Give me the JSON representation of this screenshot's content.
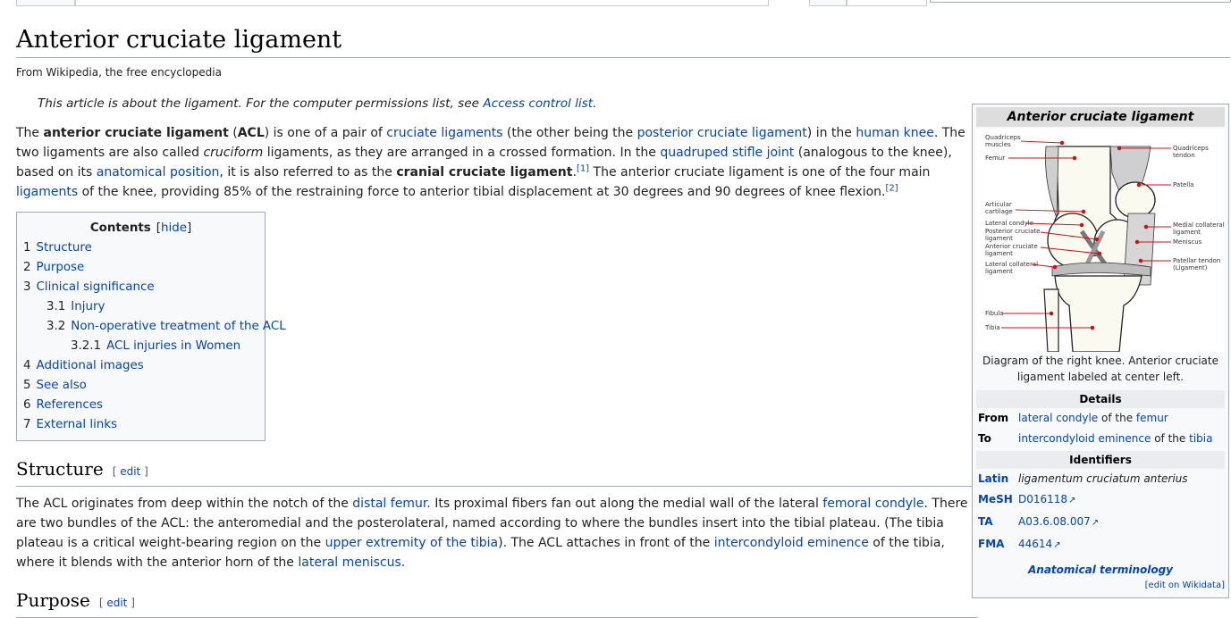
{
  "article": {
    "title": "Anterior cruciate ligament",
    "site_sub": "From Wikipedia, the free encyclopedia",
    "hatnote": {
      "text": "This article is about the ligament. For the computer permissions list, see ",
      "link": "Access control list",
      "end": "."
    },
    "intro": {
      "s1": "The ",
      "b1": "anterior cruciate ligament",
      "s2": " (",
      "b2": "ACL",
      "s3": ") is one of a pair of ",
      "l1": "cruciate ligaments",
      "s4": " (the other being the ",
      "l2": "posterior cruciate ligament",
      "s5": ") in the ",
      "l3": "human knee",
      "s6": ". The two ligaments are also called ",
      "i1": "cruciform",
      "s7": " ligaments, as they are arranged in a crossed formation. In the ",
      "l4": "quadruped stifle joint",
      "s8": " (analogous to the knee), based on its ",
      "l5": "anatomical position",
      "s9": ", it is also referred to as the ",
      "b3": "cranial cruciate ligament",
      "s10": ".",
      "ref1": "[1]",
      "s11": " The anterior cruciate ligament is one of the four main ",
      "l6": "ligaments",
      "s12": " of the knee, providing 85% of the restraining force to anterior tibial displacement at 30 degrees and 90 degrees of knee flexion.",
      "ref2": "[2]"
    },
    "toc": {
      "title": "Contents",
      "toggle": "hide",
      "items": [
        {
          "num": "1",
          "label": "Structure"
        },
        {
          "num": "2",
          "label": "Purpose"
        },
        {
          "num": "3",
          "label": "Clinical significance"
        },
        {
          "num": "3.1",
          "label": "Injury"
        },
        {
          "num": "3.2",
          "label": "Non-operative treatment of the ACL"
        },
        {
          "num": "3.2.1",
          "label": "ACL injuries in Women"
        },
        {
          "num": "4",
          "label": "Additional images"
        },
        {
          "num": "5",
          "label": "See also"
        },
        {
          "num": "6",
          "label": "References"
        },
        {
          "num": "7",
          "label": "External links"
        }
      ]
    },
    "structure": {
      "heading": "Structure",
      "edit_open": "[ ",
      "edit": "edit",
      "edit_close": " ]",
      "s1": "The ACL originates from deep within the notch of the ",
      "l1": "distal femur",
      "s2": ". Its proximal fibers fan out along the medial wall of the lateral ",
      "l2": "femoral condyle",
      "s3": ". There are two bundles of the ACL: the anteromedial and the posterolateral, named according to where the bundles insert into the tibial plateau. (The tibia plateau is a critical weight-bearing region on the ",
      "l3": "upper extremity of the tibia",
      "s4": "). The ACL attaches in front of the ",
      "l4": "intercondyloid eminence",
      "s5": " of the tibia, where it blends with the anterior horn of the ",
      "l5": "lateral meniscus",
      "s6": "."
    },
    "purpose": {
      "heading": "Purpose",
      "edit_open": "[ ",
      "edit": "edit",
      "edit_close": " ]"
    }
  },
  "infobox": {
    "title": "Anterior cruciate ligament",
    "caption": "Diagram of the right knee. Anterior cruciate ligament labeled at center left.",
    "diagram_labels_left": [
      "Quadriceps muscles",
      "Femur",
      "Articular cartilage",
      "Lateral condyle",
      "Posterior cruciate ligament",
      "Anterior cruciate ligament",
      "Lateral collateral ligament",
      "Fibula",
      "Tibia"
    ],
    "diagram_labels_right": [
      "Quadriceps tendon",
      "Patella",
      "Medial collateral ligament",
      "Meniscus",
      "Patellar tendon (Ligament)"
    ],
    "details_heading": "Details",
    "from_label": "From",
    "from_link1": "lateral condyle",
    "from_mid": " of the ",
    "from_link2": "femur",
    "to_label": "To",
    "to_link1": "intercondyloid eminence",
    "to_mid": " of the ",
    "to_link2": "tibia",
    "identifiers_heading": "Identifiers",
    "latin_label": "Latin",
    "latin_value": "ligamentum cruciatum anterius",
    "mesh_label": "MeSH",
    "mesh_value": "D016118",
    "ta_label": "TA",
    "ta_value": "A03.6.08.007",
    "fma_label": "FMA",
    "fma_value": "44614",
    "footer": "Anatomical terminology",
    "wikidata": "[edit on Wikidata]"
  },
  "colors": {
    "link": "#0645ad",
    "text": "#222222",
    "border": "#a2a9b1",
    "infobox_bg": "#f8f9fa",
    "infobox_title_bg": "#dddddd",
    "infobox_head_bg": "#eaecf0",
    "diagram_red": "#d01010"
  },
  "icons": {
    "external_link": "external-link-icon"
  }
}
